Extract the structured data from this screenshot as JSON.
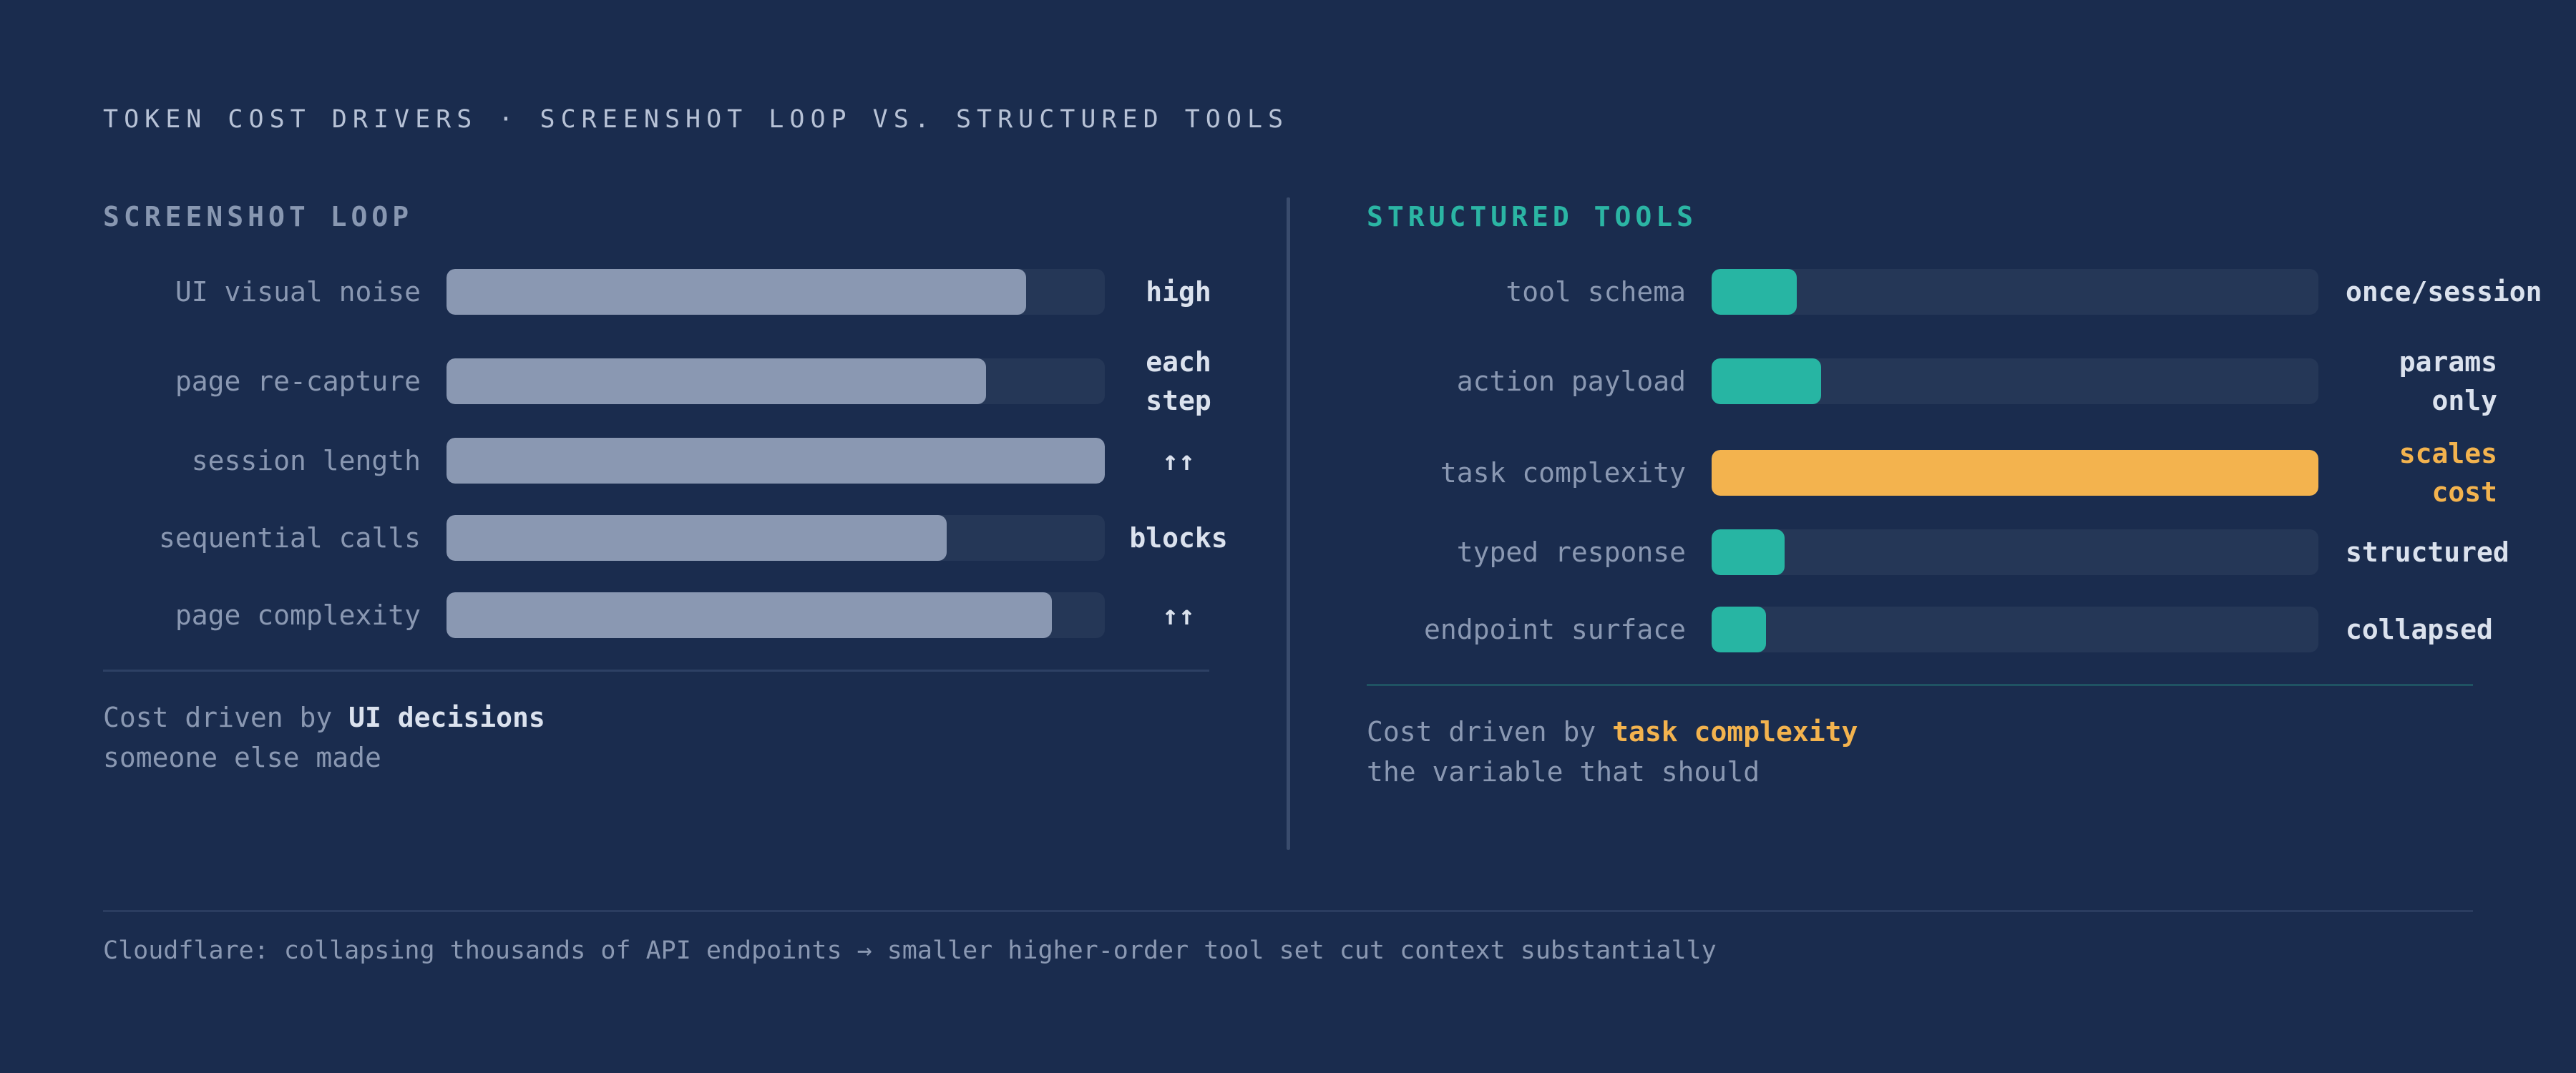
{
  "title": "TOKEN COST DRIVERS · SCREENSHOT LOOP VS. STRUCTURED TOOLS",
  "colors": {
    "background": "#1a2c4e",
    "track": "#253757",
    "neutral_bar": "#8a98b2",
    "accent_teal": "#27b5a3",
    "accent_orange": "#f3b34e",
    "value_text": "#dbe2ee"
  },
  "screenshot_loop": {
    "heading": "SCREENSHOT LOOP",
    "rows": [
      {
        "label": "UI visual noise",
        "level": 0.88,
        "value": "high"
      },
      {
        "label": "page re-capture",
        "level": 0.82,
        "value": "each\nstep"
      },
      {
        "label": "session length",
        "level": 1.0,
        "value": "↑↑"
      },
      {
        "label": "sequential calls",
        "level": 0.76,
        "value": "blocks"
      },
      {
        "label": "page complexity",
        "level": 0.92,
        "value": "↑↑"
      }
    ],
    "summary": {
      "prefix": "Cost driven by ",
      "emphasis": "UI decisions",
      "line2": "someone else made"
    }
  },
  "structured_tools": {
    "heading": "STRUCTURED TOOLS",
    "rows": [
      {
        "label": "tool schema",
        "level": 0.14,
        "value": "once/session"
      },
      {
        "label": "action payload",
        "level": 0.18,
        "value": "params\nonly"
      },
      {
        "label": "task complexity",
        "level": 1.0,
        "value": "scales\ncost"
      },
      {
        "label": "typed response",
        "level": 0.12,
        "value": "structured"
      },
      {
        "label": "endpoint surface",
        "level": 0.09,
        "value": "collapsed"
      }
    ],
    "summary": {
      "prefix": "Cost driven by ",
      "emphasis": "task complexity",
      "line2": "the variable that should"
    }
  },
  "footer": "Cloudflare: collapsing thousands of API endpoints → smaller higher-order tool set cut context substantially"
}
